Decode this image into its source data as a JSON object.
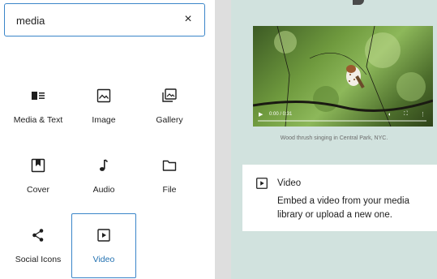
{
  "search": {
    "value": "media",
    "clear_label": "×"
  },
  "blocks": [
    {
      "label": "Media & Text",
      "icon": "media-text-icon"
    },
    {
      "label": "Image",
      "icon": "image-icon"
    },
    {
      "label": "Gallery",
      "icon": "gallery-icon"
    },
    {
      "label": "Cover",
      "icon": "cover-icon"
    },
    {
      "label": "Audio",
      "icon": "audio-icon"
    },
    {
      "label": "File",
      "icon": "file-icon"
    },
    {
      "label": "Social Icons",
      "icon": "share-icon"
    },
    {
      "label": "Video",
      "icon": "video-icon",
      "selected": true
    }
  ],
  "preview": {
    "video_time": "0:00 / 0:31",
    "caption": "Wood thrush singing in Central Park, NYC.",
    "card_title": "Video",
    "card_description": "Embed a video from your media library or upload a new one."
  },
  "colors": {
    "accent": "#3a85c9",
    "preview_bg": "#d1e2de",
    "divider": "#dedede"
  }
}
